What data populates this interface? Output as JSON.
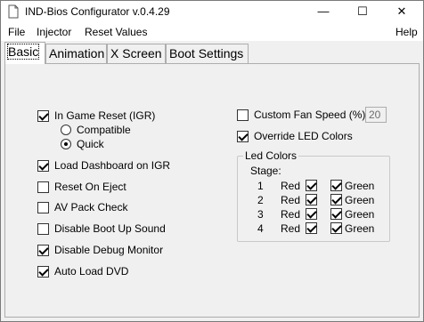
{
  "window": {
    "title": "IND-Bios Configurator v.0.4.29",
    "minimize_glyph": "—",
    "maximize_glyph": "☐",
    "close_glyph": "✕",
    "icon": "file-icon"
  },
  "menu": {
    "file": "File",
    "injector": "Injector",
    "reset_values": "Reset Values",
    "help": "Help"
  },
  "tabs": [
    {
      "label": "Basic",
      "active": true
    },
    {
      "label": "Animation",
      "active": false
    },
    {
      "label": "X Screen",
      "active": false
    },
    {
      "label": "Boot Settings",
      "active": false
    }
  ],
  "basic": {
    "igr": {
      "label": "In Game Reset (IGR)",
      "checked": true
    },
    "igr_mode": {
      "compatible": {
        "label": "Compatible",
        "selected": false
      },
      "quick": {
        "label": "Quick",
        "selected": true
      }
    },
    "load_dashboard": {
      "label": "Load Dashboard on IGR",
      "checked": true
    },
    "reset_on_eject": {
      "label": "Reset On Eject",
      "checked": false
    },
    "av_pack_check": {
      "label": "AV Pack Check",
      "checked": false
    },
    "disable_boot_sound": {
      "label": "Disable Boot Up Sound",
      "checked": false
    },
    "disable_debug_monitor": {
      "label": "Disable Debug Monitor",
      "checked": true
    },
    "auto_load_dvd": {
      "label": "Auto Load DVD",
      "checked": true
    },
    "custom_fan_speed": {
      "label": "Custom Fan Speed (%)",
      "checked": false,
      "value": "20"
    },
    "override_led": {
      "label": "Override LED Colors",
      "checked": true
    },
    "led_colors": {
      "title": "Led Colors",
      "stage_label": "Stage:",
      "red_label": "Red",
      "green_label": "Green",
      "stages": [
        {
          "num": "1",
          "red": true,
          "green": true
        },
        {
          "num": "2",
          "red": true,
          "green": true
        },
        {
          "num": "3",
          "red": true,
          "green": true
        },
        {
          "num": "4",
          "red": true,
          "green": true
        }
      ]
    }
  }
}
